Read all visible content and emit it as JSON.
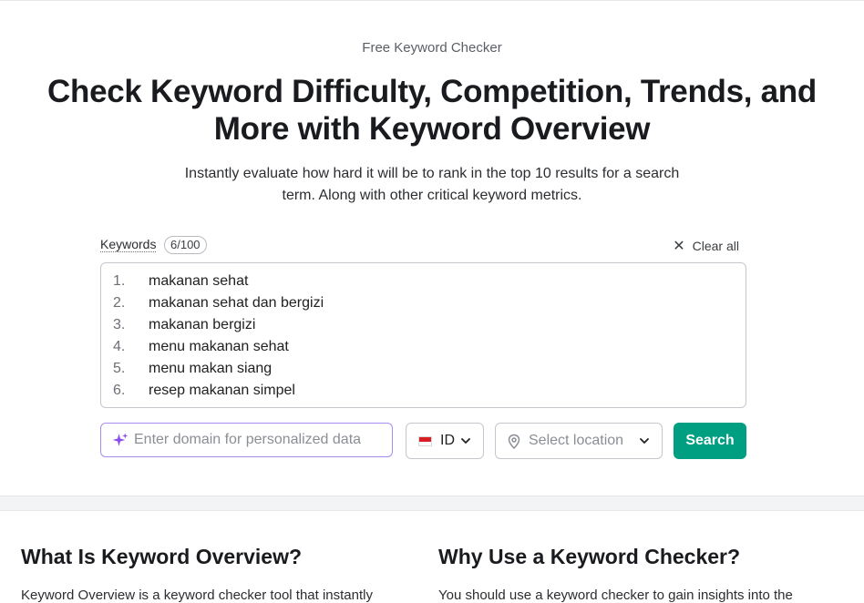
{
  "hero": {
    "eyebrow": "Free Keyword Checker",
    "title": "Check Keyword Difficulty, Competition, Trends, and More with Keyword Overview",
    "subtitle": "Instantly evaluate how hard it will be to rank in the top 10 results for a search term. Along with other critical keyword metrics."
  },
  "keywords_panel": {
    "label": "Keywords",
    "count": "6/100",
    "clear_all_label": "Clear all",
    "items": [
      {
        "num": "1.",
        "text": "makanan sehat"
      },
      {
        "num": "2.",
        "text": "makanan sehat dan bergizi"
      },
      {
        "num": "3.",
        "text": "makanan bergizi"
      },
      {
        "num": "4.",
        "text": "menu makanan sehat"
      },
      {
        "num": "5.",
        "text": "menu makan siang"
      },
      {
        "num": "6.",
        "text": "resep makanan simpel"
      }
    ]
  },
  "controls": {
    "domain_placeholder": "Enter domain for personalized data",
    "domain_value": "",
    "database_code": "ID",
    "location_placeholder": "Select location",
    "search_label": "Search"
  },
  "sections": {
    "left_heading": "What Is Keyword Overview?",
    "right_heading": "Why Use a Keyword Checker?",
    "left_text": "Keyword Overview is a keyword checker tool that instantly",
    "right_text": "You should use a keyword checker to gain insights into the"
  },
  "colors": {
    "accent": "#009f81",
    "input_focus": "#a98cf0",
    "sparkle": "#8a4cf0",
    "flag_red": "#d91f26"
  },
  "icons": [
    "sparkle-icon",
    "close-icon",
    "indonesia-flag-icon",
    "chevron-down-icon",
    "location-pin-icon"
  ]
}
